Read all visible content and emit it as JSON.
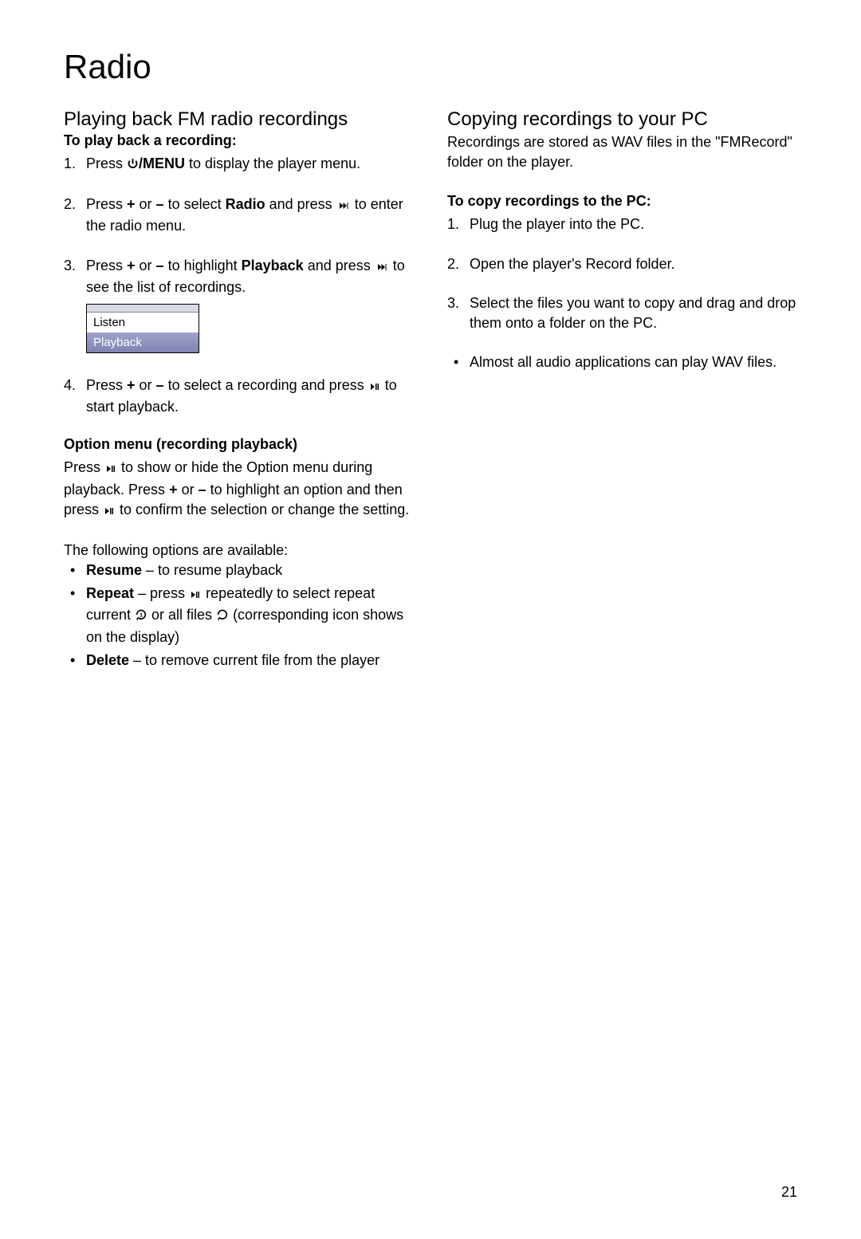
{
  "page_number": "21",
  "main_title": "Radio",
  "left": {
    "section_title": "Playing back FM radio recordings",
    "heading1": "To play back a recording:",
    "step1_a": "Press ",
    "step1_b": "/MENU",
    "step1_c": " to display the player menu.",
    "step2_a": "Press ",
    "step2_plus": "+",
    "step2_or": " or ",
    "step2_minus": "–",
    "step2_b": " to select ",
    "step2_radio": "Radio",
    "step2_c": " and press ",
    "step2_d": " to enter the radio menu.",
    "step3_a": "Press ",
    "step3_plus": "+",
    "step3_or": " or ",
    "step3_minus": "–",
    "step3_b": " to highlight ",
    "step3_playback": "Playback",
    "step3_c": " and press ",
    "step3_d": " to see the list of recordings.",
    "menu": {
      "listen": "Listen",
      "playback": "Playback"
    },
    "step4_a": "Press ",
    "step4_plus": "+",
    "step4_or": " or ",
    "step4_minus": "–",
    "step4_b": " to select a recording and press ",
    "step4_c": " to start playback.",
    "heading2": "Option menu (recording playback)",
    "option_para_a": "Press ",
    "option_para_b": " to show or hide the Option menu during playback. Press ",
    "option_plus": "+",
    "option_or": " or ",
    "option_minus": "–",
    "option_para_c": " to highlight an option and then press ",
    "option_para_d": " to confirm the selection or change the setting.",
    "options_intro": "The following options are available:",
    "resume_b": "Resume",
    "resume_t": " – to resume playback",
    "repeat_b": "Repeat",
    "repeat_t1": " – press ",
    "repeat_t2": " repeatedly to select repeat current ",
    "repeat_t3": " or all files ",
    "repeat_t4": "  (corresponding icon shows on the display)",
    "delete_b": "Delete",
    "delete_t": " – to remove current file from the player"
  },
  "right": {
    "section_title": "Copying recordings to your PC",
    "intro": "Recordings are stored as WAV files in the \"FMRecord\" folder on the player.",
    "heading": "To copy recordings to the PC:",
    "step1": "Plug the player into the PC.",
    "step2": "Open the player's Record folder.",
    "step3": "Select the files you want to copy and drag and drop them onto a folder on the PC.",
    "bullet1": "Almost all audio applications can play WAV files."
  }
}
